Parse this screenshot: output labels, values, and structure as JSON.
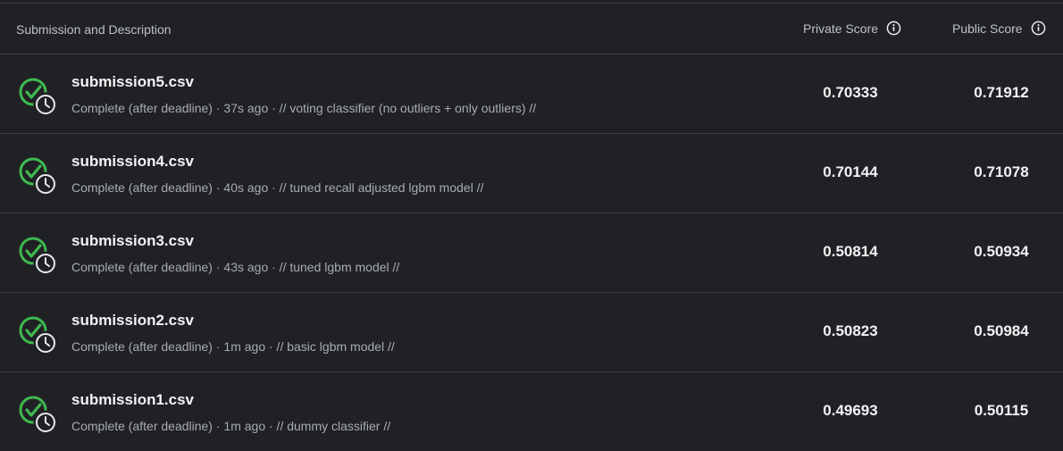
{
  "header": {
    "description_label": "Submission and Description",
    "private_label": "Private Score",
    "public_label": "Public Score"
  },
  "icons": {
    "info": "info-icon",
    "status": "check-circle-icon",
    "clock": "clock-icon"
  },
  "colors": {
    "background": "#202124",
    "success": "#3fb950",
    "divider": "#3c4043"
  },
  "rows": [
    {
      "file": "submission5.csv",
      "meta": "Complete (after deadline) · 37s ago · // voting classifier (no outliers + only outliers) //",
      "private_score": "0.70333",
      "public_score": "0.71912"
    },
    {
      "file": "submission4.csv",
      "meta": "Complete (after deadline) · 40s ago · // tuned recall adjusted lgbm model //",
      "private_score": "0.70144",
      "public_score": "0.71078"
    },
    {
      "file": "submission3.csv",
      "meta": "Complete (after deadline) · 43s ago · // tuned lgbm model //",
      "private_score": "0.50814",
      "public_score": "0.50934"
    },
    {
      "file": "submission2.csv",
      "meta": "Complete (after deadline) · 1m ago · // basic lgbm model //",
      "private_score": "0.50823",
      "public_score": "0.50984"
    },
    {
      "file": "submission1.csv",
      "meta": "Complete (after deadline) · 1m ago · // dummy classifier //",
      "private_score": "0.49693",
      "public_score": "0.50115"
    }
  ]
}
